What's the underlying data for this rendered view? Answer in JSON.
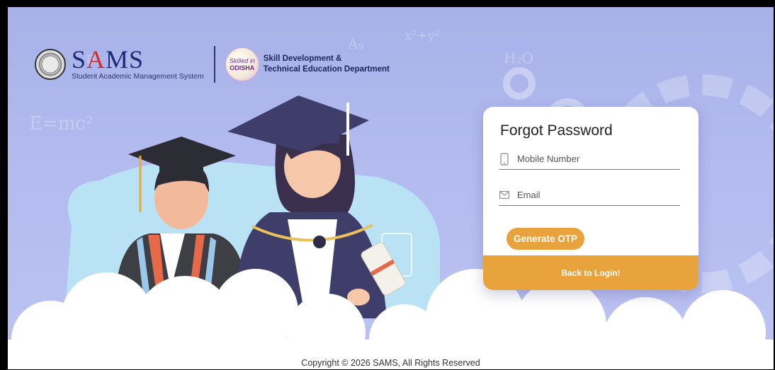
{
  "header": {
    "sams_title_s": "S",
    "sams_title_a": "A",
    "sams_title_ms": "MS",
    "sams_subtitle": "Student Academic Management System",
    "odisha_logo_text_1": "Skilled in",
    "odisha_logo_text_2": "ODISHA",
    "dept_line_1": "Skill Development &",
    "dept_line_2": "Technical Education Department"
  },
  "form": {
    "title": "Forgot Password",
    "mobile_placeholder": "Mobile Number",
    "mobile_value": "",
    "email_placeholder": "Email",
    "email_value": "",
    "generate_otp_label": "Generate OTP",
    "back_to_login_label": "Back to Login!"
  },
  "footer": {
    "copyright": "Copyright © 2026 SAMS, All Rights Reserved"
  },
  "icons": {
    "mobile": "mobile-phone-icon",
    "email": "envelope-icon",
    "emblem": "odisha-emblem-icon"
  },
  "colors": {
    "accent": "#e8a33c",
    "background": "#b0b9ee",
    "brand_blue": "#1e2a78",
    "brand_red": "#d12b2b"
  }
}
